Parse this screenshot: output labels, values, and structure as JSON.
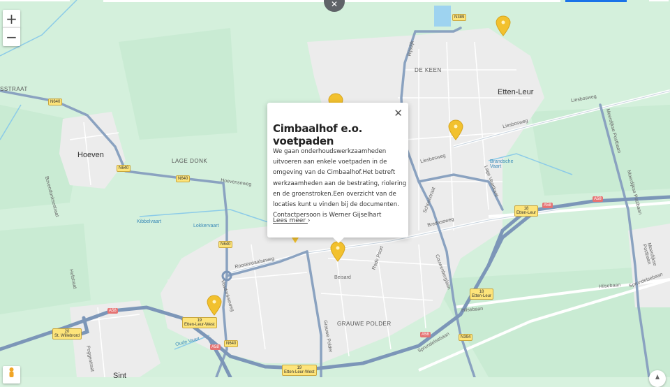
{
  "map": {
    "zoom_in_label": "+",
    "zoom_out_label": "−",
    "close_top_label": "✕",
    "pegman_icon": "pegman-icon",
    "compass_icon": "compass-icon",
    "marker_color": "#f2c12e"
  },
  "popup": {
    "title": "Cimbaalhof e.o. voetpaden",
    "body": "We gaan onderhoudswerkzaamheden uitvoeren aan enkele voetpaden in de omgeving van de Cimbaalhof.Het betreft werkzaamheden aan de bestrating, riolering en de groenstroken.Een overzicht van de locaties kunt u vinden bij de documenten. Contactpersoon is Werner Gijselhart",
    "link_label": "Lees meer",
    "close_label": "✕"
  },
  "labels": {
    "hoeven": "Hoeven",
    "etten_leur": "Etten-Leur",
    "de_keen": "DE KEEN",
    "lage_donk": "LAGE DONK",
    "grauwe_polder": "GRAUWE POLDER",
    "sint": "Sint",
    "sstraat": "SSTRAAT",
    "hoevenseweg": "Hoevenseweg",
    "roosendaalseweg": "Roosendaalseweg",
    "vosdonkseweg": "Vosdonkseweg",
    "kibbelvaart": "Kibbelvaart",
    "lokkervaart": "Lokkervaart",
    "liesbosweg1": "Liesbosweg",
    "liesbosweg2": "Liesbosweg",
    "liesbosweg3": "Liesbosweg",
    "bredaseweg": "Bredaseweg",
    "hilsebaan1": "Hilsebaan",
    "hilsebaan2": "Hilsebaan",
    "sprundelsebaan": "Sprundelsebaan",
    "sprundelsebaan2": "Sprundelsebaan",
    "brandsche_vaart": "Brandsche Vaart",
    "oude_vaart": "Oude Vaart",
    "beisard": "Beisard",
    "rode_poort": "Rode Poort",
    "grauwe_polder_road": "Grauwe Polder",
    "hofstraat": "Hofstraat",
    "bovendonkseweg": "Bovendonksestraat",
    "rijsdijk": "Rijsdijk",
    "lage_vaartkant": "Lage Vaartkant",
    "schoolstraat": "Schoolstraat",
    "couwenberg": "Couwenberglaan",
    "moerdijkse_postbaan": "Moerdijkse Postbaan",
    "moerdijkse_postbaan2": "Moerdijkse Postbaan",
    "moerdijkse_postbaan3": "Moerdijkse Postbaan",
    "pogge": "Poggestraat"
  },
  "shields": {
    "n640a": "N640",
    "n640b": "N640",
    "n640c": "N640",
    "n640d": "N640",
    "n640e": "N640",
    "n389": "N389",
    "n394": "N394",
    "a58a": "A58",
    "a58b": "A58",
    "a58c": "A58",
    "a58d": "A58",
    "a58e": "A58",
    "x20": "20",
    "x20name": "St. Willebrord",
    "x19a": "19",
    "x19aname": "Etten-Leur-West",
    "x19b": "19",
    "x19bname": "Etten-Leur-West",
    "x18a": "18",
    "x18aname": "Etten-Leur",
    "x18b": "18",
    "x18bname": "Etten-Leur"
  }
}
